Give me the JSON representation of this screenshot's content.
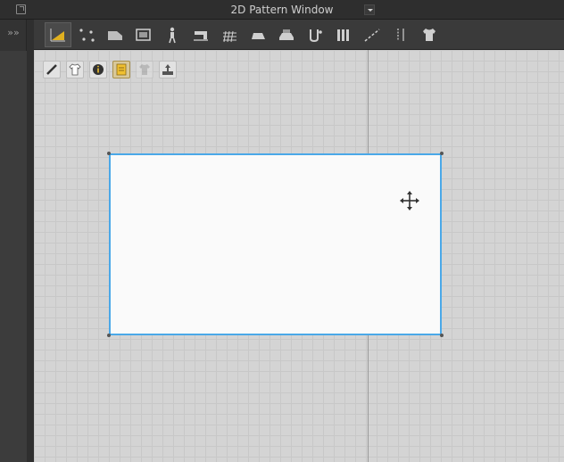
{
  "window": {
    "title": "2D Pattern Window",
    "undock_icon": "undock-icon",
    "dropdown_icon": "chevron-down-icon"
  },
  "sidebar": {
    "expand_label": "»»"
  },
  "toolbar": {
    "tools": [
      {
        "name": "transform-pattern-tool",
        "active": true
      },
      {
        "name": "edit-point-tool",
        "active": false
      },
      {
        "name": "polygon-tool",
        "active": false
      },
      {
        "name": "rectangle-tool",
        "active": false
      },
      {
        "name": "internal-shape-tool",
        "active": false
      },
      {
        "name": "sewing-tool",
        "active": false
      },
      {
        "name": "grid-tool",
        "active": false
      },
      {
        "name": "trace-tool",
        "active": false
      },
      {
        "name": "fold-tool",
        "active": false
      },
      {
        "name": "free-sewing-tool",
        "active": false
      },
      {
        "name": "pleat-tool",
        "active": false
      },
      {
        "name": "tape-tool",
        "active": false
      },
      {
        "name": "zipper-tool",
        "active": false
      },
      {
        "name": "garment-tool",
        "active": false
      }
    ]
  },
  "mini_toolbar": {
    "items": [
      {
        "name": "show-2d-pattern-icon",
        "on": false,
        "disabled": false
      },
      {
        "name": "show-garment-icon",
        "on": false,
        "disabled": false
      },
      {
        "name": "information-icon",
        "on": false,
        "disabled": false
      },
      {
        "name": "notes-icon",
        "on": true,
        "disabled": false
      },
      {
        "name": "garment-silhouette-icon",
        "on": false,
        "disabled": true
      },
      {
        "name": "export-icon",
        "on": false,
        "disabled": false
      }
    ]
  },
  "colors": {
    "selection_border": "#4aa8e8",
    "canvas_bg": "#d4d4d4",
    "pattern_fill": "#fafafa"
  },
  "pattern": {
    "shape": "rectangle",
    "selected": true
  }
}
